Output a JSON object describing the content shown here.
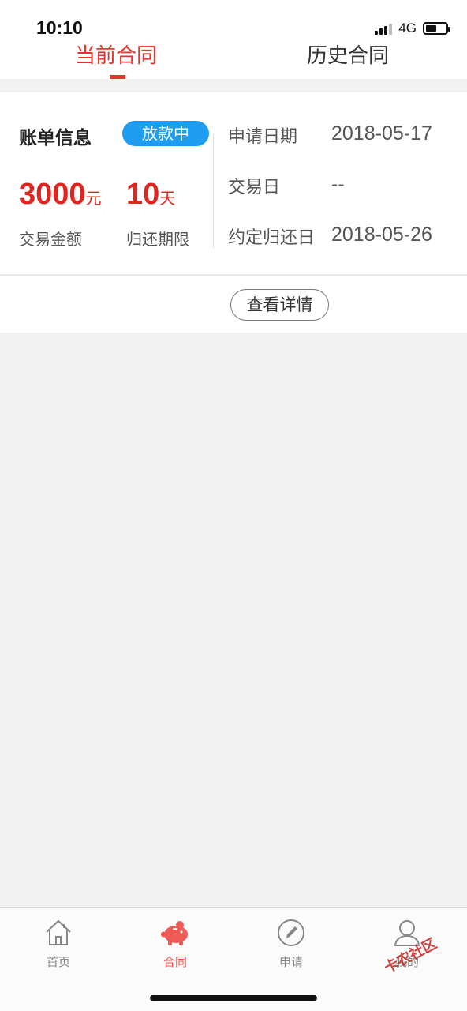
{
  "status_bar": {
    "time": "10:10",
    "network": "4G"
  },
  "tabs": [
    {
      "label": "当前合同",
      "active": true
    },
    {
      "label": "历史合同",
      "active": false
    }
  ],
  "bill": {
    "title": "账单信息",
    "status": "放款中",
    "amount": "3000",
    "amount_unit": "元",
    "amount_label": "交易金额",
    "term": "10",
    "term_unit": "天",
    "term_label": "归还期限",
    "info": [
      {
        "label": "申请日期",
        "value": "2018-05-17"
      },
      {
        "label": "交易日",
        "value": "--"
      },
      {
        "label": "约定归还日",
        "value": "2018-05-26"
      }
    ]
  },
  "detail_button": "查看详情",
  "tabbar": [
    {
      "label": "首页",
      "icon": "home-icon"
    },
    {
      "label": "合同",
      "icon": "piggy-bank-icon",
      "active": true
    },
    {
      "label": "申请",
      "icon": "pencil-icon"
    },
    {
      "label": "我的",
      "icon": "user-icon"
    }
  ],
  "watermark": "卡农社区",
  "colors": {
    "accent": "#e8332b",
    "badge": "#1e9cf0",
    "amount": "#e0241f",
    "tab_active": "#e8533f"
  }
}
